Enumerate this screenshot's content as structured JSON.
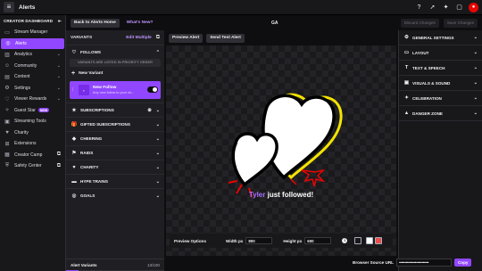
{
  "topbar": {
    "title": "Alerts",
    "menu_icon": "menu-icon",
    "icons": [
      "help-icon",
      "rocket-icon",
      "magic-icon",
      "chat-icon"
    ],
    "avatar_color": "#eb0400"
  },
  "sidebar": {
    "header": "CREATOR DASHBOARD",
    "collapse_glyph": "⇤",
    "items": [
      {
        "label": "Stream Manager",
        "icon": "broadcast-icon",
        "glyph": "▭"
      },
      {
        "label": "Alerts",
        "icon": "alerts-icon",
        "glyph": "◎",
        "active": true
      },
      {
        "label": "Analytics",
        "icon": "analytics-icon",
        "glyph": "▥",
        "chevron": true
      },
      {
        "label": "Community",
        "icon": "community-icon",
        "glyph": "☺",
        "chevron": true
      },
      {
        "label": "Content",
        "icon": "content-icon",
        "glyph": "▤",
        "chevron": true
      },
      {
        "label": "Settings",
        "icon": "settings-icon",
        "glyph": "⚙",
        "chevron": true
      },
      {
        "label": "Viewer Rewards",
        "icon": "rewards-icon",
        "glyph": "♡",
        "chevron": true
      },
      {
        "label": "Guest Star",
        "icon": "guest-star-icon",
        "glyph": "✧",
        "badge": "NEW"
      },
      {
        "label": "Streaming Tools",
        "icon": "tools-icon",
        "glyph": "▣"
      },
      {
        "label": "Charity",
        "icon": "charity-icon",
        "glyph": "♥"
      },
      {
        "label": "Extensions",
        "icon": "extensions-icon",
        "glyph": "⊞"
      },
      {
        "label": "Creator Camp",
        "icon": "creator-camp-icon",
        "glyph": "▦",
        "external": true
      },
      {
        "label": "Safety Center",
        "icon": "safety-icon",
        "glyph": "⛨",
        "external": true
      }
    ]
  },
  "subbar": {
    "back_label": "Back to Alerts Home",
    "whats_new": "What's New?",
    "ga_label": "GA",
    "discard_label": "Discard Changes",
    "save_label": "Save Changes"
  },
  "variants": {
    "title": "VARIANTS",
    "edit_multiple": "Edit Multiple",
    "follows": {
      "label": "FOLLOWS",
      "glyph": "♡"
    },
    "priority_note": "VARIANTS ARE LISTED IN PRIORITY ORDER",
    "new_variant": "New Variant",
    "card": {
      "name": "New Follow",
      "desc": "Any new follow to your ch..."
    },
    "categories": [
      {
        "label": "SUBSCRIPTIONS",
        "glyph": "★",
        "add": true
      },
      {
        "label": "GIFTED SUBSCRIPTIONS",
        "glyph": "🎁"
      },
      {
        "label": "CHEERING",
        "glyph": "◆"
      },
      {
        "label": "RAIDS",
        "glyph": "⚑"
      },
      {
        "label": "CHARITY",
        "glyph": "♥"
      },
      {
        "label": "HYPE TRAINS",
        "glyph": "▬"
      },
      {
        "label": "GOALS",
        "glyph": "◎"
      }
    ],
    "footer_label": "Alert Variants",
    "footer_count": "13/100",
    "count_used": 13,
    "count_max": 100
  },
  "preview": {
    "preview_alert": "Preview Alert",
    "send_test": "Send Test Alert",
    "username": "Tyler",
    "message": " just followed!",
    "options_label": "Preview Options",
    "width_label": "Width px",
    "width_value": "800",
    "height_label": "Height px",
    "height_value": "600",
    "swatch_colors": [
      "#18181b",
      "#ffffff",
      "#eb4d4b"
    ]
  },
  "settings": {
    "items": [
      {
        "label": "GENERAL SETTINGS",
        "glyph": "⚙"
      },
      {
        "label": "LAYOUT",
        "glyph": "▭"
      },
      {
        "label": "TEXT & SPEECH",
        "glyph": "T"
      },
      {
        "label": "VISUALS & SOUND",
        "glyph": "▣"
      },
      {
        "label": "CELEBRATION",
        "glyph": "✦"
      },
      {
        "label": "DANGER ZONE",
        "glyph": "▲"
      }
    ]
  },
  "browser_source": {
    "label": "Browser Source URL",
    "value": "••••••••••••••••••••••••••",
    "copy_label": "Copy"
  }
}
